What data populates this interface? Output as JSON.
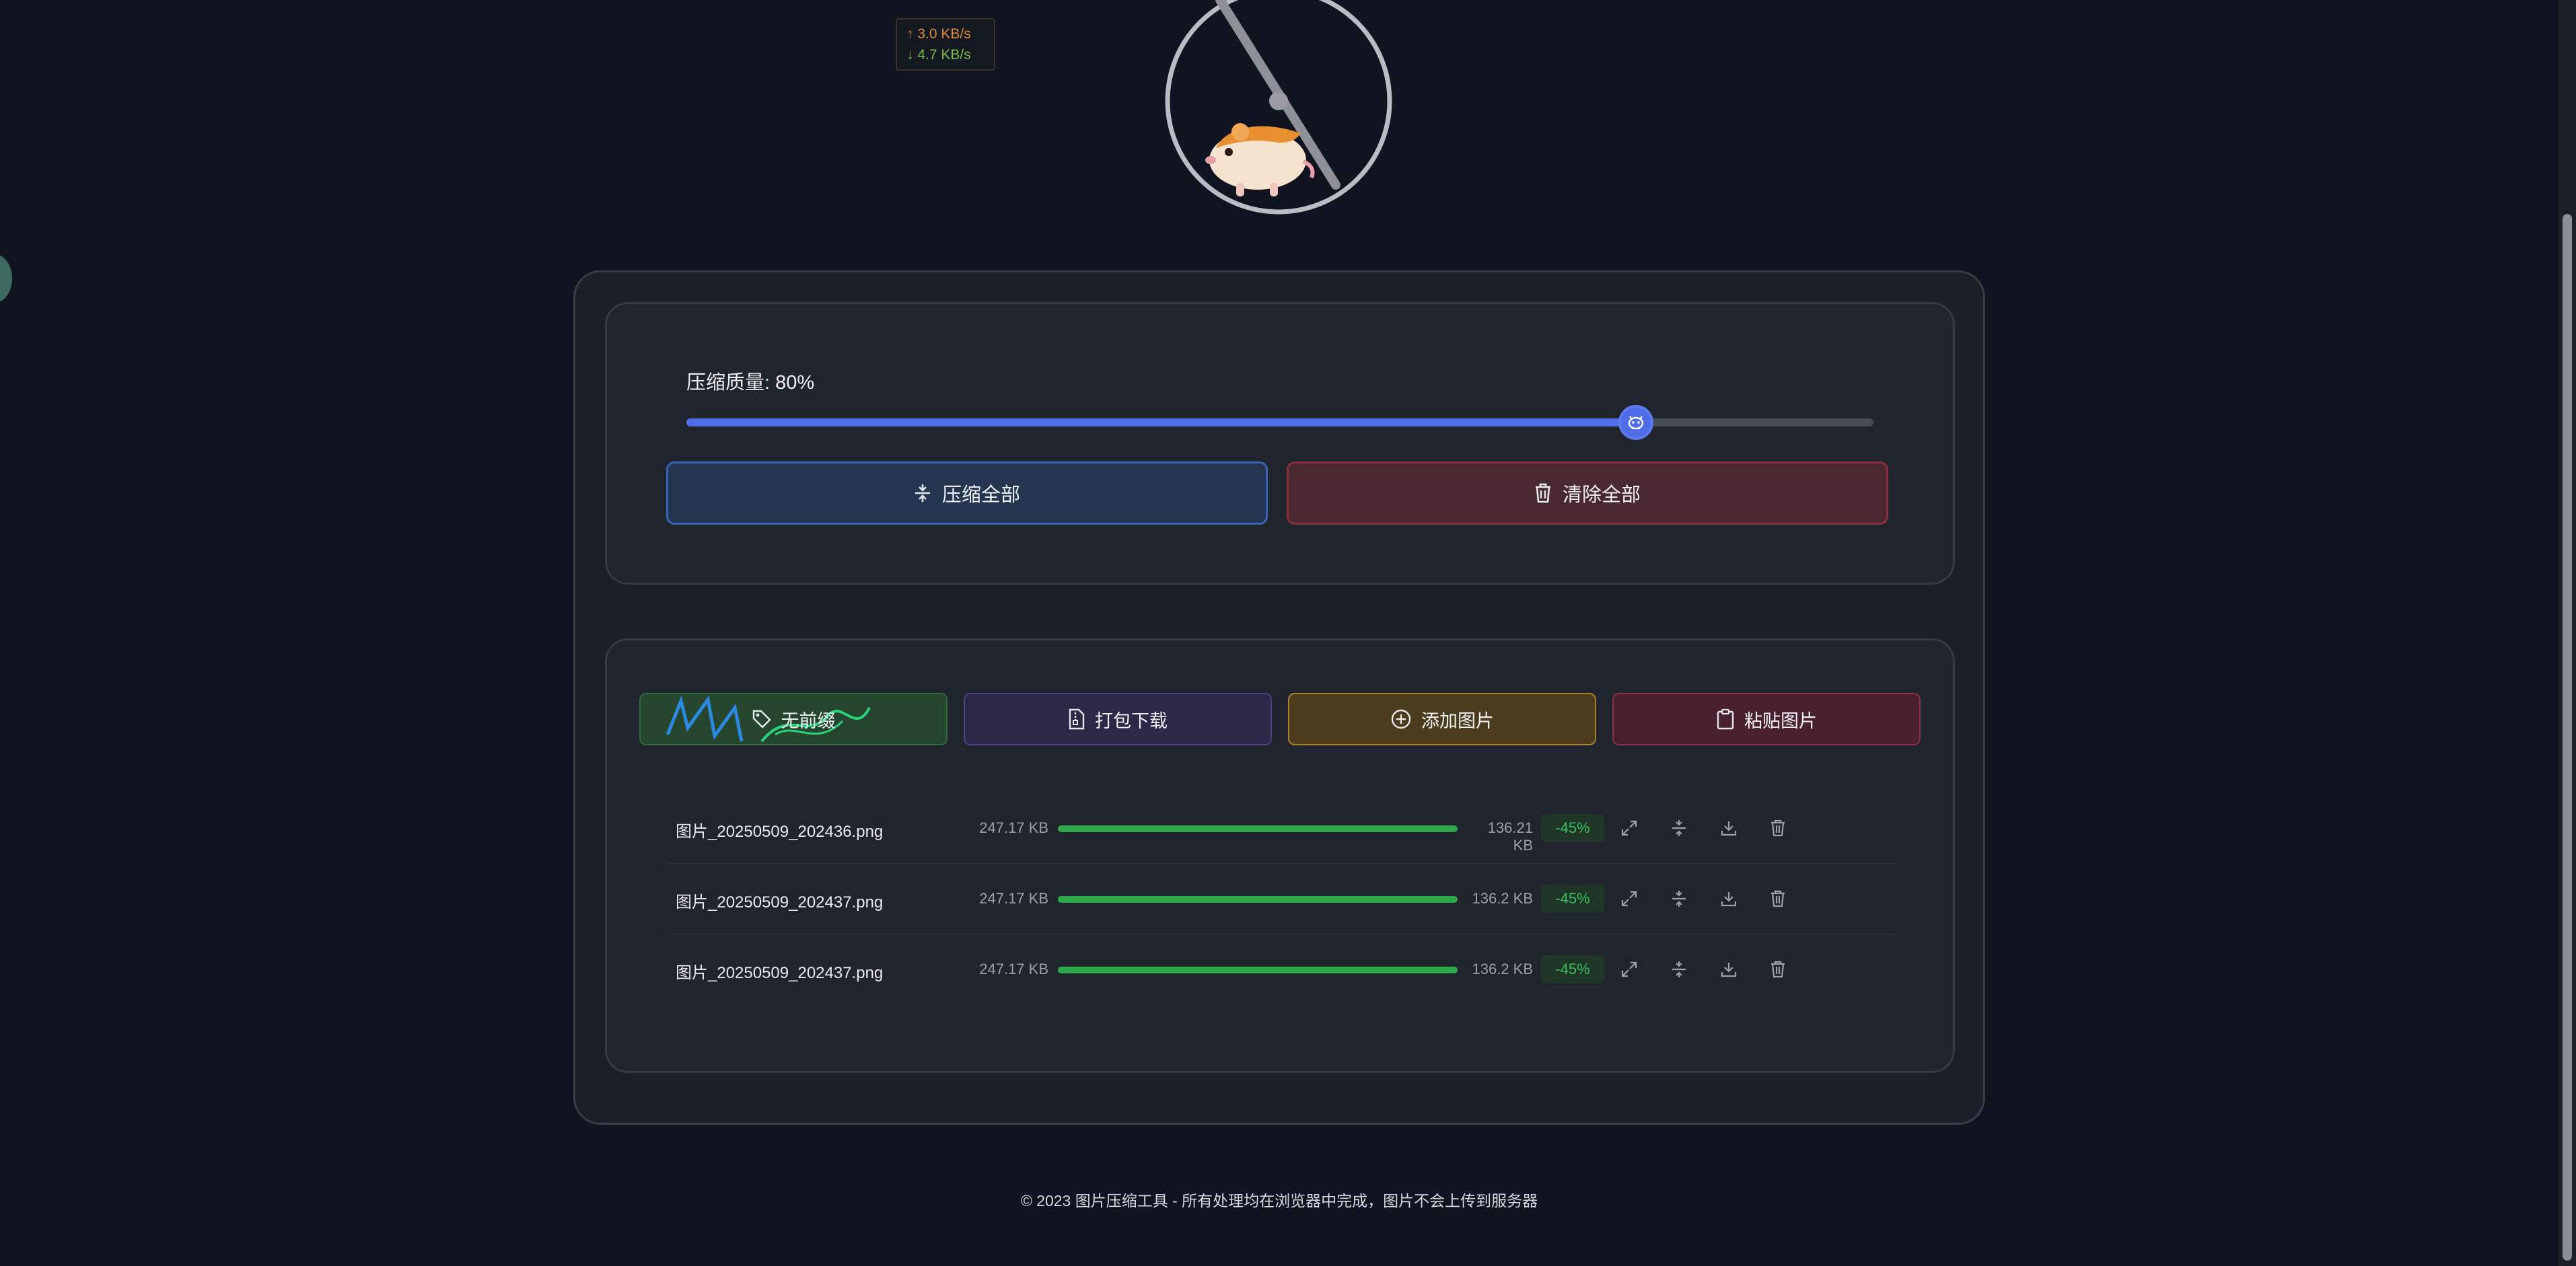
{
  "speed": {
    "upload": "↑ 3.0 KB/s",
    "download": "↓ 4.7 KB/s"
  },
  "controls": {
    "quality_label": "压缩质量: 80%",
    "quality_value": 80,
    "compress_all": "压缩全部",
    "clear_all": "清除全部"
  },
  "actions": {
    "no_bg": "无前缀",
    "zip_download": "打包下载",
    "add_images": "添加图片",
    "paste_images": "粘贴图片"
  },
  "files": [
    {
      "name": "图片_20250509_202436.png",
      "original": "247.17 KB",
      "compressed": "136.21 KB",
      "saving": "-45%"
    },
    {
      "name": "图片_20250509_202437.png",
      "original": "247.17 KB",
      "compressed": "136.2 KB",
      "saving": "-45%"
    },
    {
      "name": "图片_20250509_202437.png",
      "original": "247.17 KB",
      "compressed": "136.2 KB",
      "saving": "-45%"
    }
  ],
  "footer": "© 2023 图片压缩工具 - 所有处理均在浏览器中完成，图片不会上传到服务器",
  "colors": {
    "accent": "#4f6de6",
    "progress": "#2ea84a",
    "danger": "#8a2f3c",
    "background": "#0f1420"
  },
  "icons": {
    "compress": "compress-icon",
    "trash": "trash-icon",
    "tag": "tag-icon",
    "zip": "file-zip-icon",
    "add": "plus-circle-icon",
    "paste": "clipboard-icon",
    "expand": "expand-icon",
    "download": "download-icon"
  }
}
